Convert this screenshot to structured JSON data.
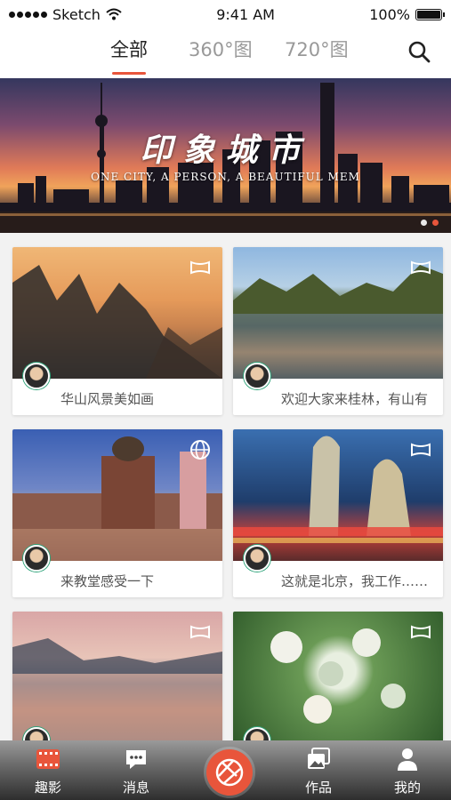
{
  "status": {
    "carrier": "Sketch",
    "time": "9:41 AM",
    "battery": "100%"
  },
  "tabs": [
    {
      "label": "全部",
      "active": true
    },
    {
      "label": "360°图",
      "active": false
    },
    {
      "label": "720°图",
      "active": false
    }
  ],
  "search": {
    "icon": "search-icon"
  },
  "banner": {
    "title": "印象城市",
    "subtitle": "ONE CITY, A PERSON, A BEAUTIFUL MEM",
    "pages": 2,
    "current_page": 2
  },
  "cards": [
    {
      "caption": "华山风景美如画",
      "type_icon": "panorama-icon"
    },
    {
      "caption": "欢迎大家来桂林，有山有",
      "type_icon": "panorama-icon"
    },
    {
      "caption": "来教堂感受一下",
      "type_icon": "globe-icon"
    },
    {
      "caption": "这就是北京，我工作……",
      "type_icon": "panorama-icon"
    },
    {
      "caption": "",
      "type_icon": "panorama-icon"
    },
    {
      "caption": "",
      "type_icon": "panorama-icon"
    }
  ],
  "nav": {
    "items": [
      {
        "label": "趣影",
        "icon": "film-icon",
        "active": true
      },
      {
        "label": "消息",
        "icon": "message-icon",
        "active": false
      },
      {
        "label": "",
        "icon": "camera-shutter-icon",
        "active": false
      },
      {
        "label": "作品",
        "icon": "gallery-icon",
        "active": false
      },
      {
        "label": "我的",
        "icon": "user-icon",
        "active": false
      }
    ]
  },
  "colors": {
    "accent": "#e8553b"
  }
}
